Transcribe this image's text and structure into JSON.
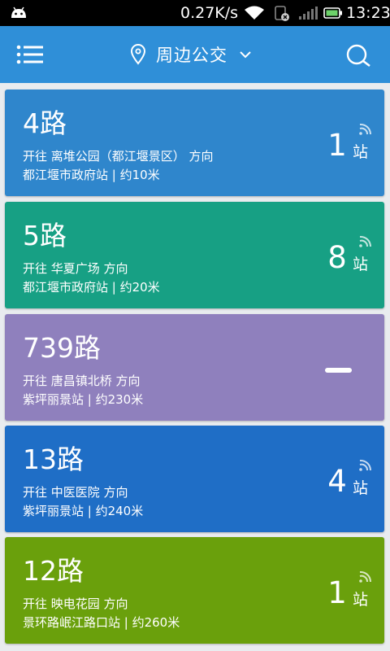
{
  "status_bar": {
    "net_speed": "0.27K/s",
    "time": "13:23"
  },
  "app_bar": {
    "title": "周边公交"
  },
  "routes": [
    {
      "name": "4路",
      "direction": "开往 离堆公园（都江堰景区） 方向",
      "stop_info": "都江堰市政府站 | 约10米",
      "stops_away": "1",
      "unit": "站",
      "color": "#2f86cc"
    },
    {
      "name": "5路",
      "direction": "开往 华夏广场 方向",
      "stop_info": "都江堰市政府站 | 约20米",
      "stops_away": "8",
      "unit": "站",
      "color": "#17a084"
    },
    {
      "name": "739路",
      "direction": "开往 唐昌镇北桥 方向",
      "stop_info": "紫坪丽景站 | 约230米",
      "stops_away": "",
      "unit": "",
      "color": "#8f80bd"
    },
    {
      "name": "13路",
      "direction": "开往 中医医院 方向",
      "stop_info": "紫坪丽景站 | 约240米",
      "stops_away": "4",
      "unit": "站",
      "color": "#1f6ec6"
    },
    {
      "name": "12路",
      "direction": "开往 映电花园 方向",
      "stop_info": "景环路岷江路口站 | 约260米",
      "stops_away": "1",
      "unit": "站",
      "color": "#6aa00c"
    }
  ]
}
